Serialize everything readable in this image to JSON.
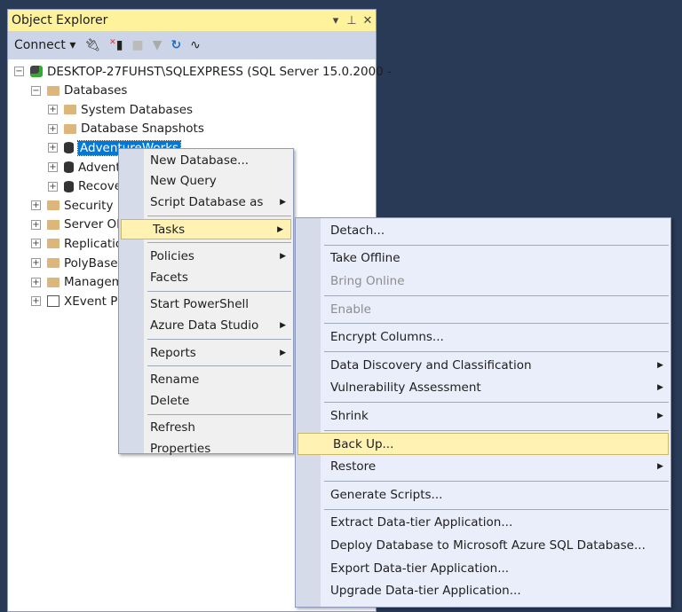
{
  "panel": {
    "title": "Object Explorer",
    "dropdown_icon": "▾",
    "pin_icon": "⊥",
    "close_icon": "✕",
    "connect_label": "Connect ▾"
  },
  "toolbar_icons": [
    "connect-plug-icon",
    "disconnect-icon",
    "stop-icon",
    "filter-icon",
    "refresh-icon",
    "activity-monitor-icon"
  ],
  "tree": [
    {
      "label": "DESKTOP-27FUHST\\SQLEXPRESS (SQL Server 15.0.2000 -",
      "level": 0,
      "exp": "−",
      "icon": "server"
    },
    {
      "label": "Databases",
      "level": 1,
      "exp": "−",
      "icon": "folder"
    },
    {
      "label": "System Databases",
      "level": 2,
      "exp": "+",
      "icon": "folder"
    },
    {
      "label": "Database Snapshots",
      "level": 2,
      "exp": "+",
      "icon": "folder"
    },
    {
      "label": "AdventureWorks",
      "level": 2,
      "exp": "+",
      "icon": "db",
      "selected": true
    },
    {
      "label": "AdventureWorks",
      "level": 2,
      "exp": "+",
      "icon": "db"
    },
    {
      "label": "Recovery",
      "level": 2,
      "exp": "+",
      "icon": "db"
    },
    {
      "label": "Security",
      "level": 1,
      "exp": "+",
      "icon": "folder"
    },
    {
      "label": "Server Objects",
      "level": 1,
      "exp": "+",
      "icon": "folder"
    },
    {
      "label": "Replication",
      "level": 1,
      "exp": "+",
      "icon": "folder"
    },
    {
      "label": "PolyBase",
      "level": 1,
      "exp": "+",
      "icon": "folder"
    },
    {
      "label": "Management",
      "level": 1,
      "exp": "+",
      "icon": "folder"
    },
    {
      "label": "XEvent Profiler",
      "level": 1,
      "exp": "+",
      "icon": "xevent"
    }
  ],
  "context_menu": [
    {
      "label": "New Database..."
    },
    {
      "label": "New Query"
    },
    {
      "label": "Script Database as",
      "sub": true
    },
    {
      "sep": true
    },
    {
      "label": "Tasks",
      "sub": true,
      "hl": true
    },
    {
      "sep": true
    },
    {
      "label": "Policies",
      "sub": true
    },
    {
      "label": "Facets"
    },
    {
      "sep": true
    },
    {
      "label": "Start PowerShell"
    },
    {
      "label": "Azure Data Studio",
      "sub": true
    },
    {
      "sep": true
    },
    {
      "label": "Reports",
      "sub": true
    },
    {
      "sep": true
    },
    {
      "label": "Rename"
    },
    {
      "label": "Delete"
    },
    {
      "sep": true
    },
    {
      "label": "Refresh"
    },
    {
      "label": "Properties"
    }
  ],
  "tasks_menu": [
    {
      "label": "Detach..."
    },
    {
      "sep": true
    },
    {
      "label": "Take Offline"
    },
    {
      "label": "Bring Online",
      "disabled": true
    },
    {
      "sep": true
    },
    {
      "label": "Enable",
      "disabled": true
    },
    {
      "sep": true
    },
    {
      "label": "Encrypt Columns..."
    },
    {
      "sep": true
    },
    {
      "label": "Data Discovery and Classification",
      "sub": true
    },
    {
      "label": "Vulnerability Assessment",
      "sub": true
    },
    {
      "sep": true
    },
    {
      "label": "Shrink",
      "sub": true
    },
    {
      "sep": true
    },
    {
      "label": "Back Up...",
      "hl": true
    },
    {
      "label": "Restore",
      "sub": true
    },
    {
      "sep": true
    },
    {
      "label": "Generate Scripts..."
    },
    {
      "sep": true
    },
    {
      "label": "Extract Data-tier Application..."
    },
    {
      "label": "Deploy Database to Microsoft Azure SQL Database..."
    },
    {
      "label": "Export Data-tier Application..."
    },
    {
      "label": "Upgrade Data-tier Application..."
    }
  ]
}
